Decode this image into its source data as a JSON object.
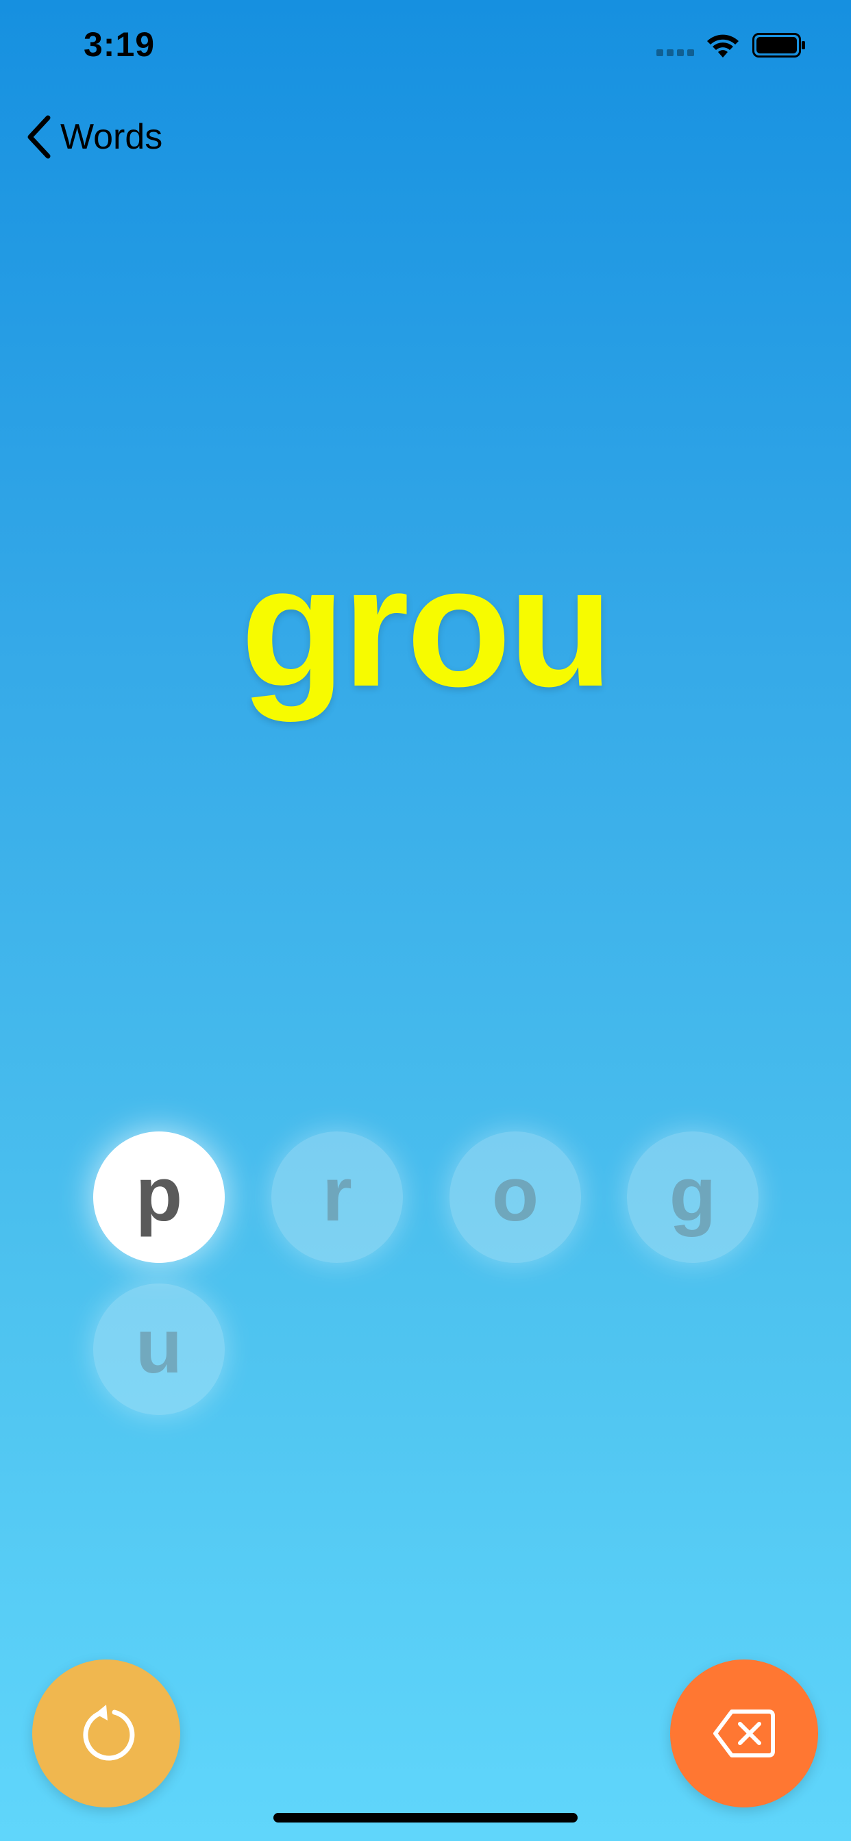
{
  "status_bar": {
    "time": "3:19",
    "signal_icon": "cellular-signal-icon",
    "wifi_icon": "wifi-icon",
    "battery_icon": "battery-icon"
  },
  "nav": {
    "back_label": "Words",
    "back_icon": "chevron-left-icon"
  },
  "word": {
    "current_text": "grou",
    "color": "#f7fb00"
  },
  "tiles": [
    {
      "letter": "p",
      "state": "active"
    },
    {
      "letter": "r",
      "state": "used"
    },
    {
      "letter": "o",
      "state": "used"
    },
    {
      "letter": "g",
      "state": "used"
    },
    {
      "letter": "u",
      "state": "used"
    }
  ],
  "buttons": {
    "reset": {
      "icon": "rotate-ccw-icon",
      "color": "#f0b74f"
    },
    "delete": {
      "icon": "delete-backspace-icon",
      "color": "#ff7732"
    }
  },
  "colors": {
    "background_top": "#1690e0",
    "background_bottom": "#60d6fb"
  }
}
